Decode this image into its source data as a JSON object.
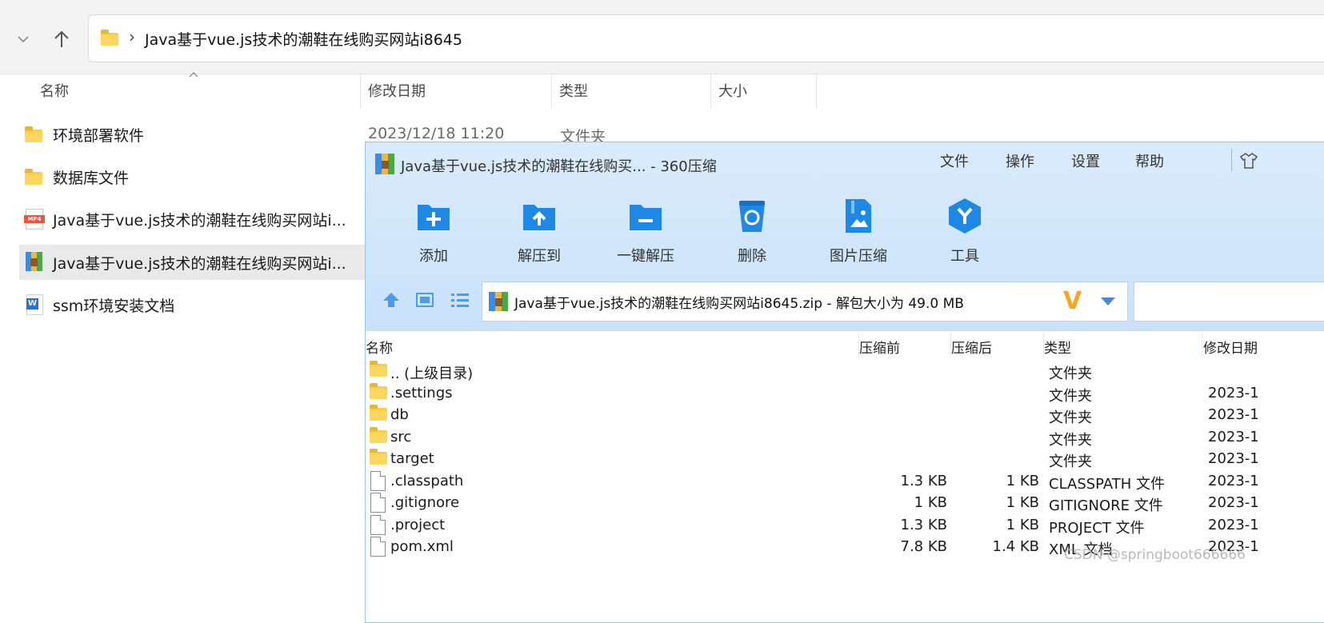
{
  "explorer": {
    "address": "Java基于vue.js技术的潮鞋在线购买网站i8645",
    "address_separator": "›",
    "headers": {
      "name": "名称",
      "date": "修改日期",
      "type": "类型",
      "size": "大小"
    },
    "items": [
      {
        "label": "环境部署软件",
        "icon": "folder-icon",
        "date": "2023/12/18 11:20",
        "type": "文件夹"
      },
      {
        "label": "数据库文件",
        "icon": "folder-icon"
      },
      {
        "label": "Java基于vue.js技术的潮鞋在线购买网站i...",
        "icon": "mp4-file-icon",
        "icon_text": "MP4"
      },
      {
        "label": "Java基于vue.js技术的潮鞋在线购买网站i...",
        "icon": "zip-archive-icon",
        "selected": true
      },
      {
        "label": "ssm环境安装文档",
        "icon": "word-doc-icon",
        "icon_text": "W"
      }
    ]
  },
  "zip": {
    "title": "Java基于vue.js技术的潮鞋在线购买... - 360压缩",
    "menu": [
      "文件",
      "操作",
      "设置",
      "帮助"
    ],
    "tools": [
      {
        "label": "添加",
        "icon": "add-icon"
      },
      {
        "label": "解压到",
        "icon": "extract-to-icon"
      },
      {
        "label": "一键解压",
        "icon": "one-click-extract-icon"
      },
      {
        "label": "删除",
        "icon": "delete-icon"
      },
      {
        "label": "图片压缩",
        "icon": "image-compress-icon"
      },
      {
        "label": "工具",
        "icon": "tools-icon"
      }
    ],
    "path": "Java基于vue.js技术的潮鞋在线购买网站i8645.zip - 解包大小为 49.0 MB",
    "path_v": "V",
    "headers": {
      "name": "名称",
      "before": "压缩前",
      "after": "压缩后",
      "type": "类型",
      "date": "修改日期"
    },
    "rows": [
      {
        "name": ".. (上级目录)",
        "icon": "folder",
        "before": "",
        "after": "",
        "type": "文件夹",
        "date": ""
      },
      {
        "name": ".settings",
        "icon": "folder",
        "before": "",
        "after": "",
        "type": "文件夹",
        "date": "2023-1"
      },
      {
        "name": "db",
        "icon": "folder",
        "before": "",
        "after": "",
        "type": "文件夹",
        "date": "2023-1"
      },
      {
        "name": "src",
        "icon": "folder",
        "before": "",
        "after": "",
        "type": "文件夹",
        "date": "2023-1"
      },
      {
        "name": "target",
        "icon": "folder",
        "before": "",
        "after": "",
        "type": "文件夹",
        "date": "2023-1"
      },
      {
        "name": ".classpath",
        "icon": "file",
        "before": "1.3 KB",
        "after": "1 KB",
        "type": "CLASSPATH 文件",
        "date": "2023-1"
      },
      {
        "name": ".gitignore",
        "icon": "file",
        "before": "1 KB",
        "after": "1 KB",
        "type": "GITIGNORE 文件",
        "date": "2023-1"
      },
      {
        "name": ".project",
        "icon": "file",
        "before": "1.3 KB",
        "after": "1 KB",
        "type": "PROJECT 文件",
        "date": "2023-1"
      },
      {
        "name": "pom.xml",
        "icon": "file",
        "before": "7.8 KB",
        "after": "1.4 KB",
        "type": "XML 文档",
        "date": "2023-1"
      }
    ]
  },
  "watermark": "CSDN @springboot666666",
  "colors": {
    "zip_header_bg": "#d3e8fb",
    "tool_blue": "#1e88e5",
    "folder_yellow": "#f9cd4a",
    "v_orange": "#f5a623"
  }
}
